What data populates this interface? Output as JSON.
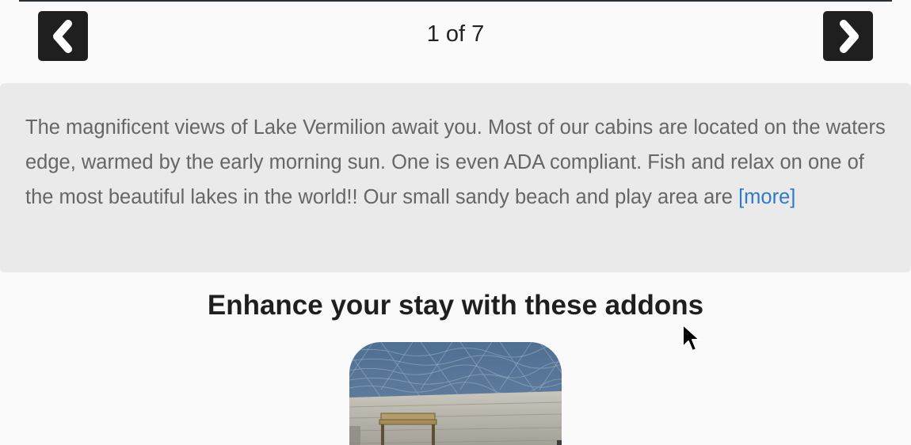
{
  "gallery": {
    "pager_text": "1 of 7",
    "prev_label": "previous",
    "next_label": "next"
  },
  "description": {
    "text": "The magnificent views of Lake Vermilion await you. Most of our cabins are located on the waters edge, warmed by the early morning sun. One is even ADA compliant. Fish and relax on one of the most beautiful lakes in the world!! Our small sandy beach and play area are ",
    "more_label": "[more]"
  },
  "addons": {
    "title": "Enhance your stay with these addons"
  },
  "colors": {
    "nav_button": "#1f1f1f",
    "link": "#2f7ac9",
    "panel": "#eaeaea",
    "page": "#fafafa"
  },
  "icons": {
    "prev": "chevron-left-icon",
    "next": "chevron-right-icon",
    "cursor": "mouse-pointer-icon"
  }
}
